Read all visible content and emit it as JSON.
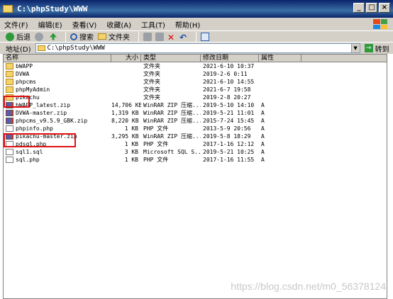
{
  "window": {
    "title": "C:\\phpStudy\\WWW"
  },
  "menu": [
    "文件(F)",
    "编辑(E)",
    "查看(V)",
    "收藏(A)",
    "工具(T)",
    "帮助(H)"
  ],
  "toolbar": {
    "back": "后退",
    "search": "搜索",
    "folders": "文件夹"
  },
  "address": {
    "label": "地址(D)",
    "value": "C:\\phpStudy\\WWW",
    "go": "转到"
  },
  "columns": {
    "name": "名称",
    "size": "大小",
    "type": "类型",
    "modified": "修改日期",
    "attr": "属性"
  },
  "files": [
    {
      "name": "bWAPP",
      "size": "",
      "type": "文件夹",
      "modified": "2021-6-10 10:37",
      "attr": "",
      "kind": "folder"
    },
    {
      "name": "DVWA",
      "size": "",
      "type": "文件夹",
      "modified": "2019-2-6 0:11",
      "attr": "",
      "kind": "folder"
    },
    {
      "name": "phpcms",
      "size": "",
      "type": "文件夹",
      "modified": "2021-6-10 14:55",
      "attr": "",
      "kind": "folder"
    },
    {
      "name": "phpMyAdmin",
      "size": "",
      "type": "文件夹",
      "modified": "2021-6-7 19:58",
      "attr": "",
      "kind": "folder"
    },
    {
      "name": "pikachu",
      "size": "",
      "type": "文件夹",
      "modified": "2019-2-8 20:27",
      "attr": "",
      "kind": "folder"
    },
    {
      "name": "bWAPP_latest.zip",
      "size": "14,706 KB",
      "type": "WinRAR ZIP 压缩...",
      "modified": "2019-5-10 14:10",
      "attr": "A",
      "kind": "zip"
    },
    {
      "name": "DVWA-master.zip",
      "size": "1,319 KB",
      "type": "WinRAR ZIP 压缩...",
      "modified": "2019-5-21 11:01",
      "attr": "A",
      "kind": "zip"
    },
    {
      "name": "phpcms_v9.5.9_GBK.zip",
      "size": "8,220 KB",
      "type": "WinRAR ZIP 压缩...",
      "modified": "2015-7-24 15:45",
      "attr": "A",
      "kind": "zip"
    },
    {
      "name": "phpinfo.php",
      "size": "1 KB",
      "type": "PHP 文件",
      "modified": "2013-5-9 20:56",
      "attr": "A",
      "kind": "file"
    },
    {
      "name": "pikachu-master.zip",
      "size": "3,295 KB",
      "type": "WinRAR ZIP 压缩...",
      "modified": "2019-5-8 18:29",
      "attr": "A",
      "kind": "zip"
    },
    {
      "name": "pdsql.php",
      "size": "1 KB",
      "type": "PHP 文件",
      "modified": "2017-1-16 12:12",
      "attr": "A",
      "kind": "file"
    },
    {
      "name": "sql1.sql",
      "size": "3 KB",
      "type": "Microsoft SQL S...",
      "modified": "2019-5-21 10:25",
      "attr": "A",
      "kind": "file"
    },
    {
      "name": "sql.php",
      "size": "1 KB",
      "type": "PHP 文件",
      "modified": "2017-1-16 11:55",
      "attr": "A",
      "kind": "file"
    }
  ],
  "watermark": "https://blog.csdn.net/m0_56378124"
}
